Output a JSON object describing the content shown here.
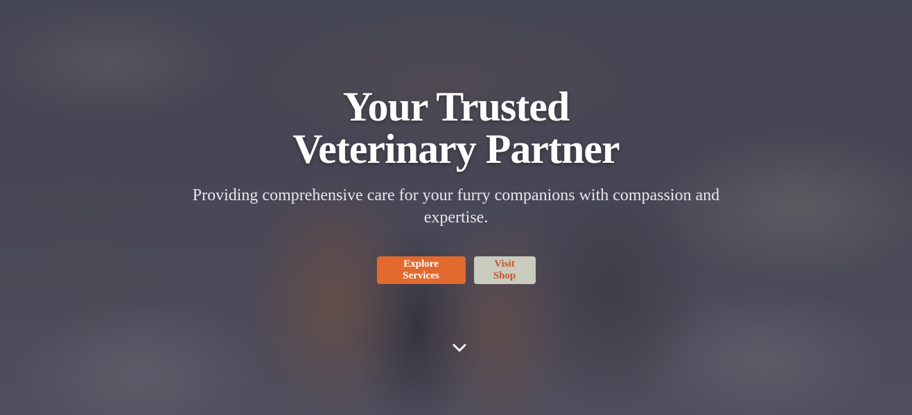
{
  "hero": {
    "background": {
      "image": "sleeping-cat-with-kittens-photo",
      "overlay_color": "#282c3e"
    },
    "title_line_1": "Your Trusted",
    "title_line_2": "Veterinary Partner",
    "subtitle": "Providing comprehensive care for your furry companions with compassion and expertise.",
    "actions": {
      "primary_label": "Explore Services",
      "secondary_label": "Visit Shop"
    },
    "scroll_icon": "chevron-down-icon"
  },
  "colors": {
    "accent": "#e26a2e",
    "secondary_button_bg": "#c9ccbf",
    "secondary_button_text": "#c8552a",
    "title_text": "#ffffff"
  }
}
